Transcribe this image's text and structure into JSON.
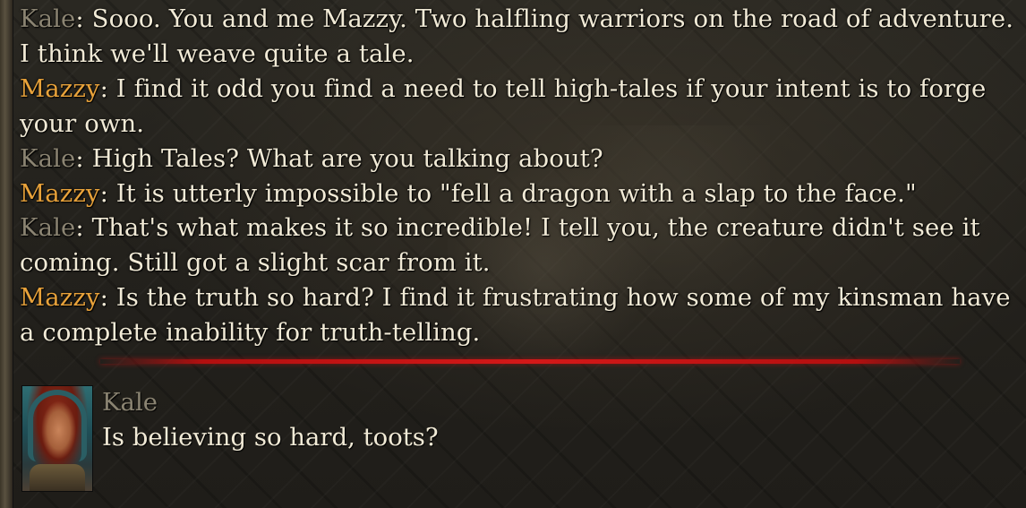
{
  "dialog_log": [
    {
      "speaker": "Kale",
      "speaker_class": "speaker-kale",
      "text": ": Sooo. You and me Mazzy. Two halfling warriors on the road of adventure. I think we'll weave quite a tale."
    },
    {
      "speaker": "Mazzy",
      "speaker_class": "speaker-mazzy",
      "text": ": I find it odd you find a need to tell high-tales if your intent is to forge your own."
    },
    {
      "speaker": "Kale",
      "speaker_class": "speaker-kale",
      "text": ": High Tales? What are you talking about?"
    },
    {
      "speaker": "Mazzy",
      "speaker_class": "speaker-mazzy",
      "text": ": It is utterly impossible to \"fell a dragon with a slap to the face.\""
    },
    {
      "speaker": "Kale",
      "speaker_class": "speaker-kale",
      "text": ": That's what makes it so incredible! I tell you, the creature didn't see it coming. Still got a slight scar from it."
    },
    {
      "speaker": "Mazzy",
      "speaker_class": "speaker-mazzy",
      "text": ": Is the truth so hard? I find it frustrating how some of my kinsman have a complete inability for truth-telling."
    }
  ],
  "current": {
    "speaker_name": "Kale",
    "line": "Is believing so hard, toots?"
  },
  "colors": {
    "kale_name": "#8b8472",
    "mazzy_name": "#e8a23a",
    "dialog_text": "#f1ead6",
    "separator": "#d41818"
  }
}
